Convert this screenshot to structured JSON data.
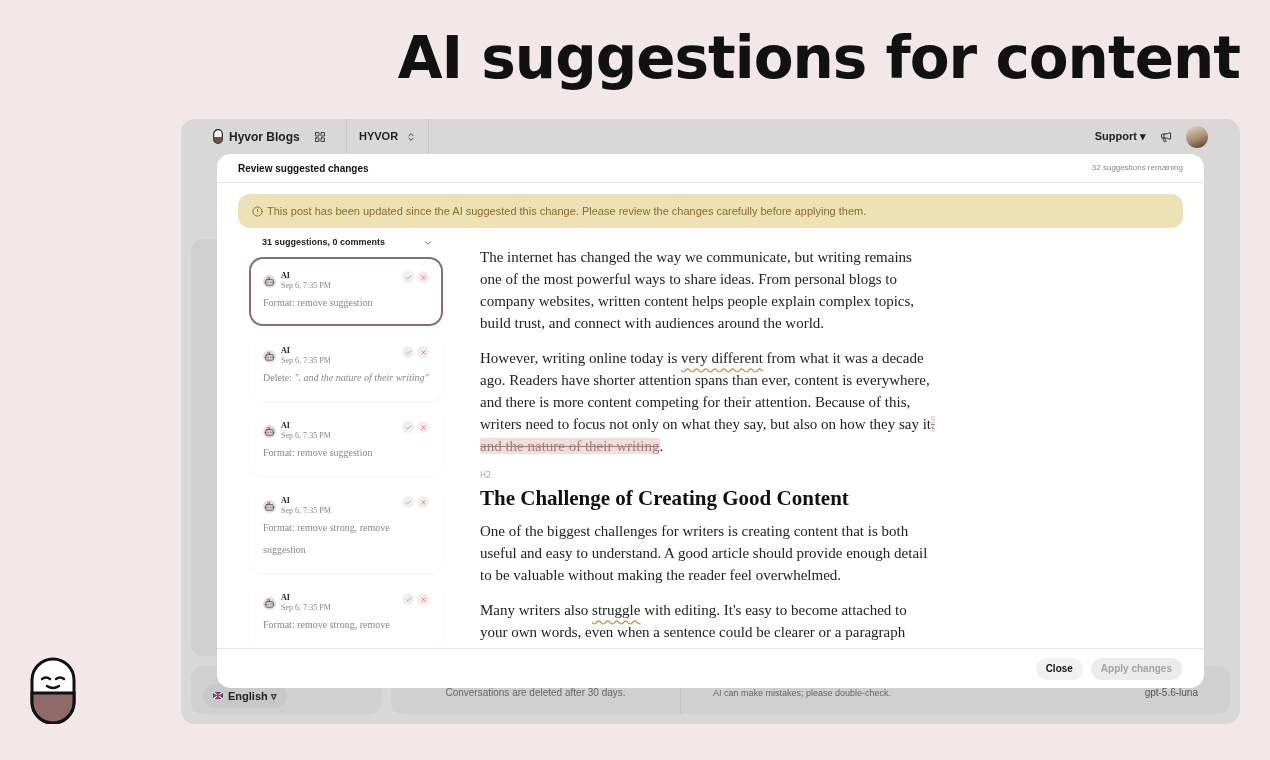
{
  "headline": "AI suggestions for content",
  "app": {
    "brand": "Hyvor Blogs",
    "workspace": "HYVOR",
    "support": "Support ▾",
    "language": "English ▿",
    "retention_note": "Conversations are deleted after 30 days.",
    "disclaimer": "AI can make mistakes; please double-check.",
    "model": "gpt-5.6-luna"
  },
  "modal": {
    "title": "Review suggested changes",
    "remaining": "32 suggestions remaining",
    "alert": "This post has been updated since the AI suggested this change. Please review the changes carefully before applying them.",
    "summary": "31 suggestions, 0 comments",
    "suggestions": [
      {
        "author": "AI",
        "time": "Sep 6, 7:35 PM",
        "kind": "format",
        "text": "Format: remove suggestion",
        "selected": true
      },
      {
        "author": "AI",
        "time": "Sep 6, 7:35 PM",
        "kind": "delete",
        "label": "Delete: ",
        "quote": "\". and the nature of their writing\"",
        "selected": false
      },
      {
        "author": "AI",
        "time": "Sep 6, 7:35 PM",
        "kind": "format",
        "text": "Format: remove suggestion",
        "selected": false
      },
      {
        "author": "AI",
        "time": "Sep 6, 7:35 PM",
        "kind": "format",
        "text": "Format: remove strong, remove suggestion",
        "selected": false
      },
      {
        "author": "AI",
        "time": "Sep 6, 7:35 PM",
        "kind": "format",
        "text": "Format: remove strong, remove",
        "selected": false
      }
    ],
    "article": [
      {
        "kind": "paragraph",
        "parts": [
          {
            "kind": "text",
            "text": "The internet has changed the way we communicate, but writing remains one of the most powerful ways to share ideas. From personal blogs to company websites, written content helps people explain complex topics, build trust, and connect with audiences around the world."
          }
        ]
      },
      {
        "kind": "paragraph",
        "parts": [
          {
            "kind": "text",
            "text": "However, writing online today is "
          },
          {
            "kind": "flag",
            "text": "very different"
          },
          {
            "kind": "text",
            "text": " from what it was a decade ago. Readers have shorter attention spans than ever, content is everywhere, and there is more content competing for their attention. Because of this, writers need to focus not only on what they say, but also on how they say it"
          },
          {
            "kind": "deleted",
            "text": ". and the nature of their writing"
          },
          {
            "kind": "text",
            "text": "."
          }
        ]
      },
      {
        "kind": "heading",
        "tag": "H2",
        "text": "The Challenge of Creating Good Content"
      },
      {
        "kind": "paragraph",
        "parts": [
          {
            "kind": "text",
            "text": "One of the biggest challenges for writers is creating content that is both useful and easy to understand. A good article should provide enough detail to be valuable without making the reader feel overwhelmed."
          }
        ]
      },
      {
        "kind": "paragraph",
        "parts": [
          {
            "kind": "text",
            "text": "Many writers also "
          },
          {
            "kind": "flag",
            "text": "struggle"
          },
          {
            "kind": "text",
            "text": " with editing. It's easy to become attached to your own words, even when a sentence could be clearer or a paragraph"
          }
        ]
      }
    ],
    "buttons": [
      {
        "label": "Close",
        "disabled": false
      },
      {
        "label": "Apply changes",
        "disabled": true
      }
    ]
  }
}
